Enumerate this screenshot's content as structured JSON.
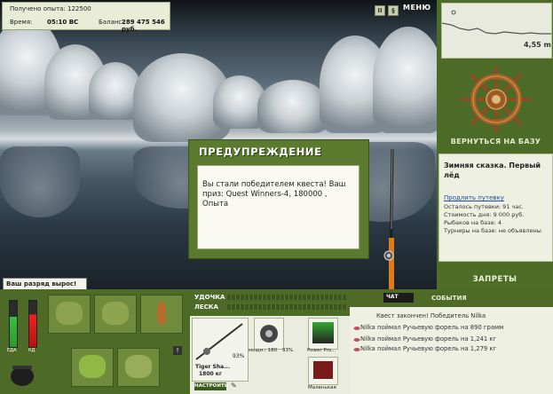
{
  "header": {
    "experience": "Получено опыта: 122500",
    "time_label": "Время:",
    "time_value": "05:10 ВС",
    "balance_label": "Баланс:",
    "balance_value": "289 475 546 руб.",
    "btn_pause": "II",
    "btn_sound": "§",
    "menu": "МЕНЮ"
  },
  "depth": {
    "value": "4,55 m"
  },
  "sidebar": {
    "return_label": "ВЕРНУТЬСЯ НА БАЗУ",
    "base_title": "Зимняя сказка. Первый лёд",
    "extend_link": "Продлить путевку",
    "lines": [
      "Осталось путевки: 91 час.",
      "Стоимость дня: 9 000 руб.",
      "Рыбаков на базе: 4",
      "Турниры на базе: не объявлены"
    ],
    "bans_label": "ЗАПРЕТЫ"
  },
  "dialog": {
    "title": "ПРЕДУПРЕЖДЕНИЕ",
    "text": "Вы стали победителем квеста! Ваш приз: Quest Winners-4, 180000 , Опыта"
  },
  "notice": {
    "text": "Ваш разряд вырос!"
  },
  "gauges": {
    "left_label": "ЕДА",
    "right_label": "КД"
  },
  "rodpanel": {
    "rod_label": "УДОЧКА",
    "line_label": "ЛЕСКА",
    "rod_name": "Tiger Sha...",
    "rod_weight": "1800 кг",
    "rod_pct": "93%",
    "reel_info": "мощн.: 180",
    "reel_pct": "93%",
    "bait_name": "Power Pro...",
    "hook_name": "Маленькая",
    "settings_btn": "НАСТРОИТЬ"
  },
  "events": {
    "tab_label": "ЧАТ",
    "label": "СОБЫТИЯ",
    "items": [
      "Квест закончен! Победитель Nilka",
      "Nilka поймал Ручьевую форель на 890 грамм",
      "Nilka поймал Ручьевую форель на 1,241 кг",
      "Nilka поймал Ручьевую форель на 1,279 кг"
    ]
  },
  "colors": {
    "sidebar_green": "#4c6b27",
    "panel_bg": "#eef0e2",
    "link_blue": "#1f49a8"
  }
}
